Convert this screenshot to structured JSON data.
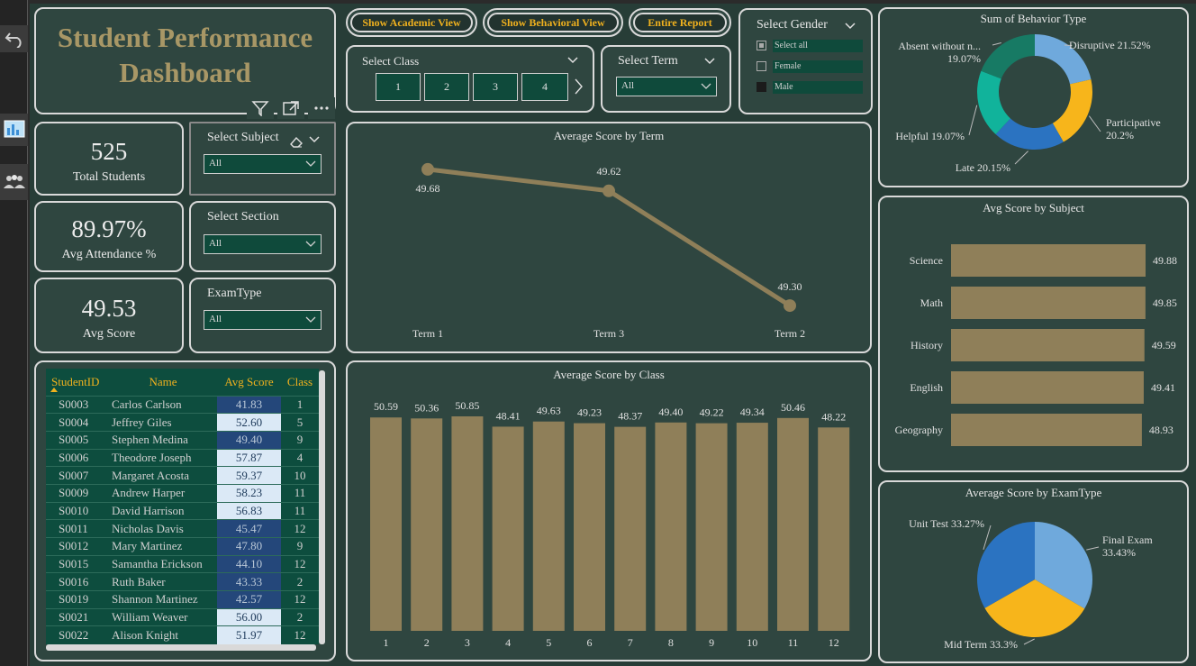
{
  "title": {
    "line1": "Student Performance",
    "line2": "Dashboard"
  },
  "nav": {
    "academic": "Show Academic View",
    "behavioral": "Show Behavioral View",
    "report": "Entire Report"
  },
  "kpis": {
    "students": {
      "value": "525",
      "label": "Total Students"
    },
    "attendance": {
      "value": "89.97%",
      "label": "Avg Attendance %"
    },
    "score": {
      "value": "49.53",
      "label": "Avg Score"
    }
  },
  "slicers": {
    "subject": {
      "title": "Select Subject",
      "value": "All"
    },
    "section": {
      "title": "Select Section",
      "value": "All"
    },
    "examtype": {
      "title": "ExamType",
      "value": "All"
    },
    "class": {
      "title": "Select Class",
      "options": [
        "1",
        "2",
        "3",
        "4"
      ]
    },
    "term": {
      "title": "Select Term",
      "value": "All"
    },
    "gender": {
      "title": "Select Gender",
      "options": [
        {
          "label": "Select all",
          "state": "partial"
        },
        {
          "label": "Female",
          "state": "off"
        },
        {
          "label": "Male",
          "state": "on"
        }
      ]
    }
  },
  "table": {
    "columns": [
      "StudentID",
      "Name",
      "Avg Score",
      "Class"
    ],
    "rows": [
      [
        "S0003",
        "Carlos Carlson",
        "41.83",
        "1"
      ],
      [
        "S0004",
        "Jeffrey Giles",
        "52.60",
        "5"
      ],
      [
        "S0005",
        "Stephen Medina",
        "49.40",
        "9"
      ],
      [
        "S0006",
        "Theodore Joseph",
        "57.87",
        "4"
      ],
      [
        "S0007",
        "Margaret Acosta",
        "59.37",
        "10"
      ],
      [
        "S0009",
        "Andrew Harper",
        "58.23",
        "11"
      ],
      [
        "S0010",
        "David Harrison",
        "56.83",
        "11"
      ],
      [
        "S0011",
        "Nicholas Davis",
        "45.47",
        "12"
      ],
      [
        "S0012",
        "Mary Martinez",
        "47.80",
        "9"
      ],
      [
        "S0015",
        "Samantha Erickson",
        "44.10",
        "12"
      ],
      [
        "S0016",
        "Ruth Baker",
        "43.33",
        "2"
      ],
      [
        "S0019",
        "Shannon Martinez",
        "42.57",
        "12"
      ],
      [
        "S0021",
        "William Weaver",
        "56.00",
        "2"
      ],
      [
        "S0022",
        "Alison Knight",
        "51.97",
        "12"
      ]
    ]
  },
  "colors": {
    "accent": "#f0b11e",
    "bar": "#8f7f59",
    "panel": "#2f4640",
    "title": "#a89766"
  },
  "chart_data": [
    {
      "id": "term",
      "type": "line",
      "title": "Average Score by Term",
      "categories": [
        "Term 1",
        "Term 3",
        "Term 2"
      ],
      "values": [
        49.68,
        49.62,
        49.3
      ]
    },
    {
      "id": "class",
      "type": "bar",
      "title": "Average Score by Class",
      "categories": [
        "1",
        "2",
        "3",
        "4",
        "5",
        "6",
        "7",
        "8",
        "9",
        "10",
        "11",
        "12"
      ],
      "values": [
        50.59,
        50.36,
        50.85,
        48.41,
        49.63,
        49.23,
        48.37,
        49.4,
        49.22,
        49.34,
        50.46,
        48.22
      ]
    },
    {
      "id": "behavior",
      "type": "pie",
      "title": "Sum of Behavior Type",
      "labels": [
        "Disruptive 21.52%",
        "Participative 20.2%",
        "Late 20.15%",
        "Helpful 19.07%",
        "Absent without n... 19.07%"
      ],
      "values": [
        21.52,
        20.2,
        20.15,
        19.07,
        19.07
      ],
      "colors": [
        "#6fa9dc",
        "#f7b51b",
        "#2b73c1",
        "#11b39b",
        "#177a64"
      ]
    },
    {
      "id": "subject",
      "type": "bar",
      "title": "Avg Score by Subject",
      "categories": [
        "Science",
        "Math",
        "History",
        "English",
        "Geography"
      ],
      "values": [
        49.88,
        49.85,
        49.59,
        49.41,
        48.93
      ]
    },
    {
      "id": "exam",
      "type": "pie",
      "title": "Average Score by ExamType",
      "labels": [
        "Final Exam 33.43%",
        "Mid Term 33.3%",
        "Unit Test 33.27%"
      ],
      "values": [
        33.43,
        33.3,
        33.27
      ],
      "colors": [
        "#6fa9dc",
        "#f7b51b",
        "#2b73c1"
      ]
    }
  ]
}
